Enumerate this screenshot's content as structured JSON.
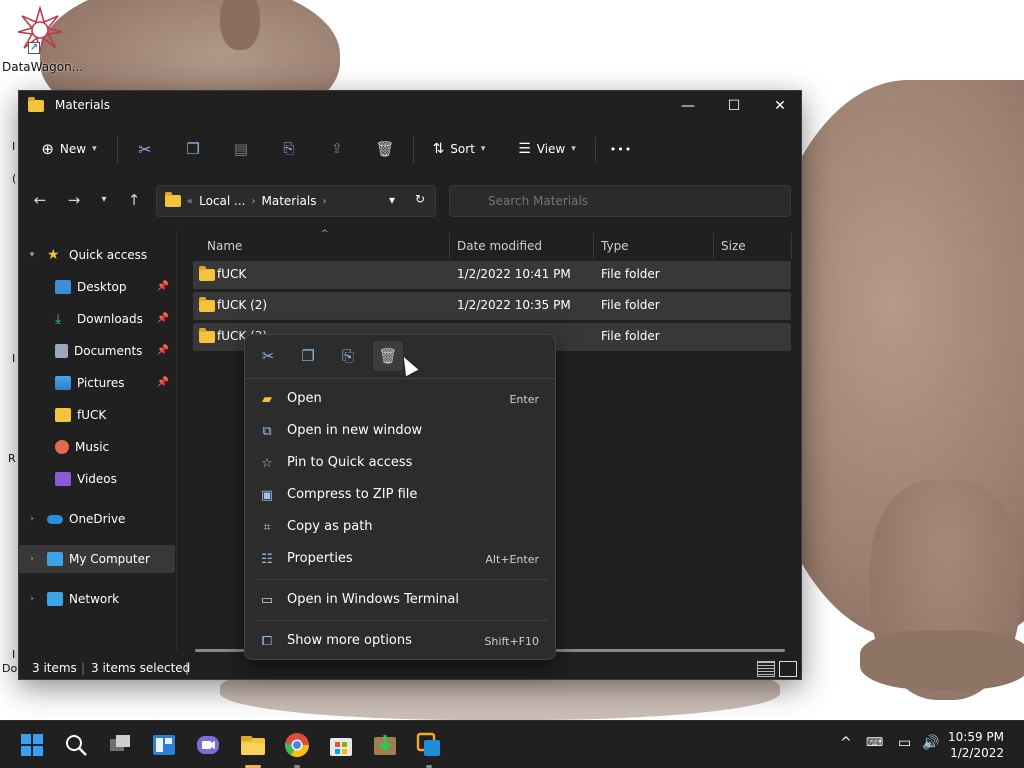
{
  "desktop": {
    "icon_label": "DataWagon...",
    "side_letters": [
      "I",
      "(",
      "I",
      "R",
      "I",
      "Do"
    ]
  },
  "window": {
    "title": "Materials",
    "controls": {
      "minimize": "—",
      "maximize": "☐",
      "close": "✕"
    }
  },
  "toolbar": {
    "new_label": "New",
    "sort_label": "Sort",
    "view_label": "View",
    "more_label": "•••"
  },
  "address": {
    "prefix": "«",
    "crumbs": [
      "Local ...",
      "Materials"
    ],
    "search_placeholder": "Search Materials"
  },
  "nav": {
    "items": [
      {
        "label": "Quick access",
        "level": 0,
        "expanded": true
      },
      {
        "label": "Desktop",
        "pinned": true
      },
      {
        "label": "Downloads",
        "pinned": true
      },
      {
        "label": "Documents",
        "pinned": true
      },
      {
        "label": "Pictures",
        "pinned": true
      },
      {
        "label": "fUCK"
      },
      {
        "label": "Music"
      },
      {
        "label": "Videos"
      },
      {
        "label": "OneDrive",
        "level": 0
      },
      {
        "label": "My Computer",
        "level": 0,
        "selected": true
      },
      {
        "label": "Network",
        "level": 0
      }
    ]
  },
  "columns": {
    "name": "Name",
    "date": "Date modified",
    "type": "Type",
    "size": "Size"
  },
  "files": [
    {
      "name": "fUCK",
      "date": "1/2/2022 10:41 PM",
      "type": "File folder"
    },
    {
      "name": "fUCK (2)",
      "date": "1/2/2022 10:35 PM",
      "type": "File folder"
    },
    {
      "name": "fUCK (3)",
      "date": "",
      "type": "File folder"
    }
  ],
  "status": {
    "items": "3 items",
    "selected": "3 items selected"
  },
  "context_menu": {
    "items": [
      {
        "label": "Open",
        "shortcut": "Enter",
        "icon": "folder-open-icon"
      },
      {
        "label": "Open in new window",
        "shortcut": "",
        "icon": "external-window-icon"
      },
      {
        "label": "Pin to Quick access",
        "shortcut": "",
        "icon": "star-icon"
      },
      {
        "label": "Compress to ZIP file",
        "shortcut": "",
        "icon": "zip-icon"
      },
      {
        "label": "Copy as path",
        "shortcut": "",
        "icon": "path-icon"
      },
      {
        "label": "Properties",
        "shortcut": "Alt+Enter",
        "icon": "properties-icon"
      },
      {
        "label": "Open in Windows Terminal",
        "shortcut": "",
        "icon": "terminal-icon"
      },
      {
        "label": "Show more options",
        "shortcut": "Shift+F10",
        "icon": "more-options-icon"
      }
    ]
  },
  "clock": {
    "time": "10:59 PM",
    "date": "1/2/2022"
  },
  "colors": {
    "accent": "#0067c0",
    "folder": "#f3c33c",
    "window_bg": "#202020",
    "menu_bg": "#2c2c2c"
  }
}
